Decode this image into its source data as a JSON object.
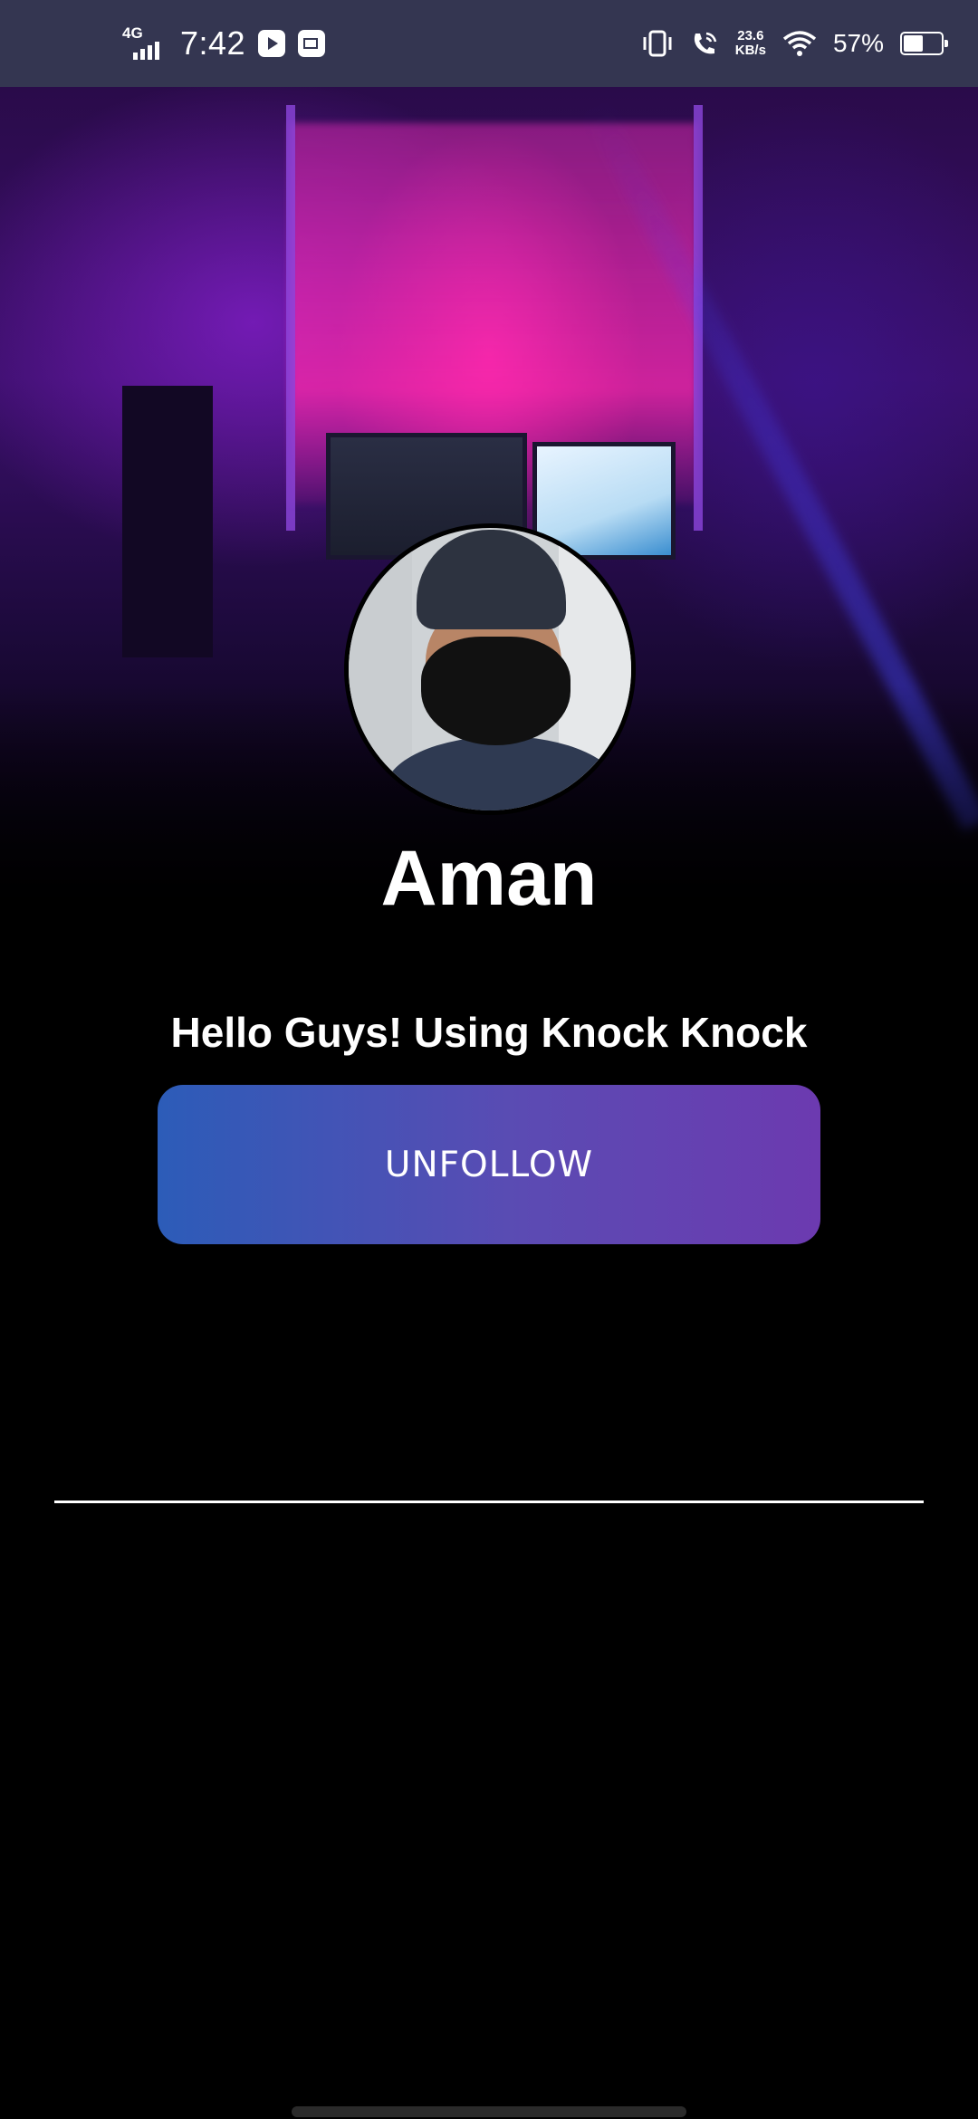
{
  "status_bar": {
    "network_type": "4G",
    "time": "7:42",
    "icons": [
      "youtube-icon",
      "mail-icon",
      "vibrate-icon",
      "wifi-calling-icon",
      "wifi-icon",
      "battery-icon"
    ],
    "speed_value": "23.6",
    "speed_unit": "KB/s",
    "battery_percent_text": "57%",
    "battery_level": 0.57
  },
  "profile": {
    "name": "Aman",
    "status_message": "Hello Guys! Using Knock Knock",
    "unfollow_label": "UNFOLLOW"
  },
  "colors": {
    "status_bar_bg": "#343651",
    "button_gradient_start": "#2c5cb8",
    "button_gradient_end": "#6c3ab0",
    "background": "#000000"
  }
}
